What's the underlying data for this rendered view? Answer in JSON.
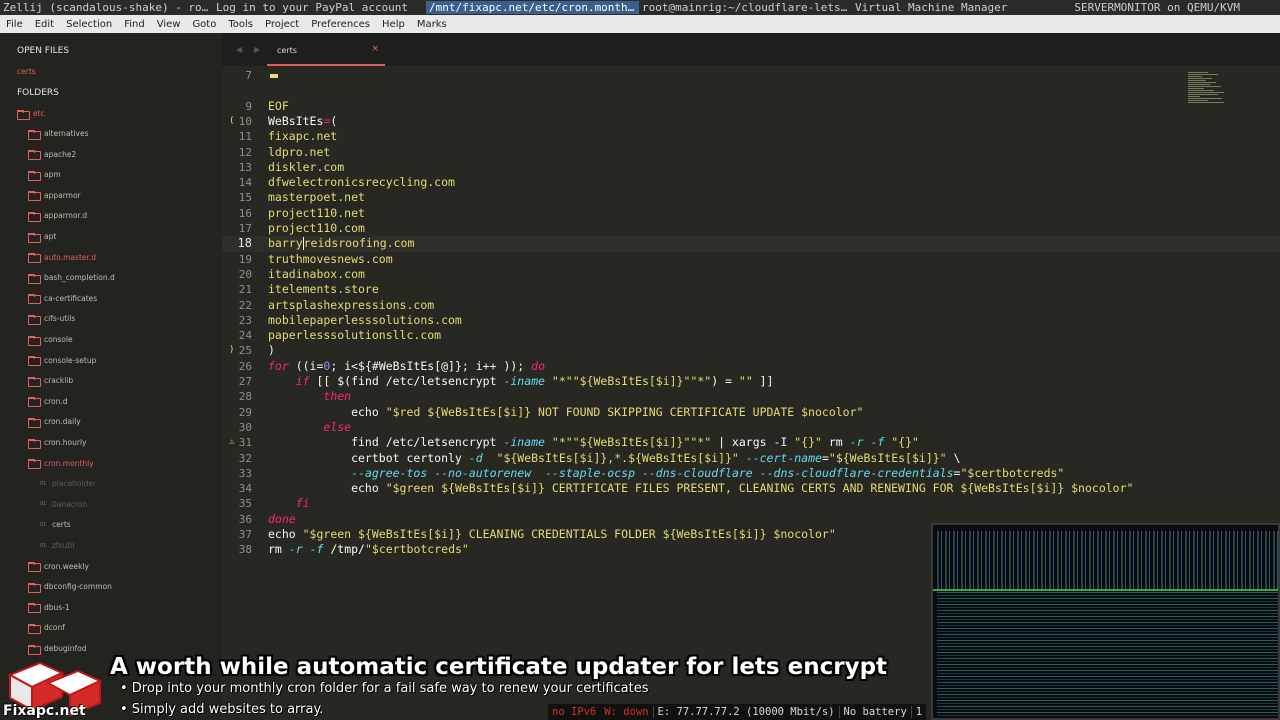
{
  "taskbar": {
    "windows": [
      "Zellij (scandalous-shake) - ro…",
      "Log in to your PayPal account",
      "/mnt/fixapc.net/etc/cron.month…",
      "root@mainrig:~/cloudflare-lets…",
      "Virtual Machine Manager"
    ],
    "right": "SERVERMONITOR on QEMU/KVM"
  },
  "menu": [
    "File",
    "Edit",
    "Selection",
    "Find",
    "View",
    "Goto",
    "Tools",
    "Project",
    "Preferences",
    "Help",
    "Marks"
  ],
  "sidebar": {
    "open_files_label": "OPEN FILES",
    "open_file": "certs",
    "folders_label": "FOLDERS",
    "root": "etc",
    "items": [
      {
        "label": "alternatives",
        "type": "folder"
      },
      {
        "label": "apache2",
        "type": "folder"
      },
      {
        "label": "apm",
        "type": "folder"
      },
      {
        "label": "apparmor",
        "type": "folder"
      },
      {
        "label": "apparmor.d",
        "type": "folder"
      },
      {
        "label": "apt",
        "type": "folder"
      },
      {
        "label": "auto.master.d",
        "type": "folder-red"
      },
      {
        "label": "bash_completion.d",
        "type": "folder"
      },
      {
        "label": "ca-certificates",
        "type": "folder"
      },
      {
        "label": "cifs-utils",
        "type": "folder"
      },
      {
        "label": "console",
        "type": "folder"
      },
      {
        "label": "console-setup",
        "type": "folder"
      },
      {
        "label": "cracklib",
        "type": "folder"
      },
      {
        "label": "cron.d",
        "type": "folder"
      },
      {
        "label": "cron.daily",
        "type": "folder"
      },
      {
        "label": "cron.hourly",
        "type": "folder"
      },
      {
        "label": "cron.monthly",
        "type": "folder-open"
      },
      {
        "label": "placeholder",
        "type": "file-dim"
      },
      {
        "label": "0anacron",
        "type": "file-dim"
      },
      {
        "label": "certs",
        "type": "file"
      },
      {
        "label": "zfsutil",
        "type": "file-dim"
      },
      {
        "label": "cron.weekly",
        "type": "folder"
      },
      {
        "label": "dbconfig-common",
        "type": "folder"
      },
      {
        "label": "dbus-1",
        "type": "folder"
      },
      {
        "label": "dconf",
        "type": "folder"
      },
      {
        "label": "debuginfod",
        "type": "folder"
      }
    ]
  },
  "tab": {
    "label": "certs",
    "close": "×"
  },
  "editor": {
    "lines": [
      {
        "n": "7",
        "text": ""
      },
      {
        "n": "",
        "text": ""
      },
      {
        "n": "9",
        "text": "EOF"
      },
      {
        "n": "10",
        "text": "WeBsItEs=("
      },
      {
        "n": "11",
        "text": "fixapc.net"
      },
      {
        "n": "12",
        "text": "ldpro.net"
      },
      {
        "n": "13",
        "text": "diskler.com"
      },
      {
        "n": "14",
        "text": "dfwelectronicsrecycling.com"
      },
      {
        "n": "15",
        "text": "masterpoet.net"
      },
      {
        "n": "16",
        "text": "project110.net"
      },
      {
        "n": "17",
        "text": "project110.com"
      },
      {
        "n": "18",
        "text": "barryreidsroofing.com"
      },
      {
        "n": "19",
        "text": "truthmovesnews.com"
      },
      {
        "n": "20",
        "text": "itadinabox.com"
      },
      {
        "n": "21",
        "text": "itelements.store"
      },
      {
        "n": "22",
        "text": "artsplashexpressions.com"
      },
      {
        "n": "23",
        "text": "mobilepaperlesssolutions.com"
      },
      {
        "n": "24",
        "text": "paperlesssolutionsllc.com"
      },
      {
        "n": "25",
        "text": ")"
      },
      {
        "n": "26",
        "text": "for ((i=0; i<${#WeBsItEs[@]}; i++ )); do"
      },
      {
        "n": "27",
        "text": "    if [[ $(find /etc/letsencrypt -iname \"*\"\"${WeBsItEs[$i]}\"\"*\") = \"\" ]]"
      },
      {
        "n": "28",
        "text": "        then"
      },
      {
        "n": "29",
        "text": "            echo \"$red ${WeBsItEs[$i]} NOT FOUND SKIPPING CERTIFICATE UPDATE $nocolor\""
      },
      {
        "n": "30",
        "text": "        else"
      },
      {
        "n": "31",
        "text": "            find /etc/letsencrypt -iname \"*\"\"${WeBsItEs[$i]}\"\"*\" | xargs -I \"{}\" rm -r -f \"{}\""
      },
      {
        "n": "32",
        "text": "            certbot certonly -d  \"${WeBsItEs[$i]},*.${WeBsItEs[$i]}\" --cert-name=\"${WeBsItEs[$i]}\" \\"
      },
      {
        "n": "33",
        "text": "            --agree-tos --no-autorenew  --staple-ocsp --dns-cloudflare --dns-cloudflare-credentials=\"$certbotcreds\""
      },
      {
        "n": "34",
        "text": "            echo \"$green ${WeBsItEs[$i]} CERTIFICATE FILES PRESENT, CLEANING CERTS AND RENEWING FOR ${WeBsItEs[$i]} $nocolor\""
      },
      {
        "n": "35",
        "text": "    fi"
      },
      {
        "n": "36",
        "text": "done"
      },
      {
        "n": "37",
        "text": "echo \"$green ${WeBsItEs[$i]} CLEANING CREDENTIALS FOLDER ${WeBsItEs[$i]} $nocolor\""
      },
      {
        "n": "38",
        "text": "rm -r -f /tmp/\"$certbotcreds\""
      }
    ]
  },
  "overlay": {
    "title": "A worth while automatic certificate updater for lets encrypt",
    "bullet1": "• Drop into your monthly cron folder for a fail safe way to renew your certificates",
    "bullet2": "• Simply add websites to array.",
    "logo_text": "Fixapc.net"
  },
  "statusbar": {
    "ipv6": "no IPv6",
    "w": "W: down",
    "e": "E: 77.77.77.2 (10000 Mbit/s)",
    "battery": "No battery",
    "extra": "1"
  },
  "colors": {
    "accent": "#e06060",
    "editor_bg": "#272822",
    "sidebar_bg": "#232420"
  }
}
